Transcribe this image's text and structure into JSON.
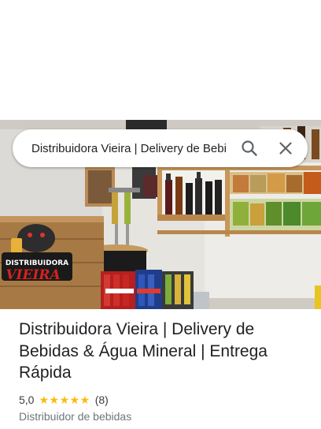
{
  "search": {
    "value": "Distribuidora Vieira | Delivery de Bebidas",
    "search_icon": "search-icon",
    "close_icon": "close-icon"
  },
  "photo": {
    "sign_line1": "DISTRIBUIDORA",
    "sign_line2": "VIEIRA"
  },
  "place": {
    "title": "Distribuidora Vieira | Delivery de Bebidas & Água Mineral | Entrega Rápida",
    "rating": "5,0",
    "stars": "★★★★★",
    "review_count": "(8)",
    "category": "Distribuidor de bebidas"
  },
  "colors": {
    "star": "#fbbc04",
    "title": "#202124",
    "secondary": "#70757a"
  }
}
